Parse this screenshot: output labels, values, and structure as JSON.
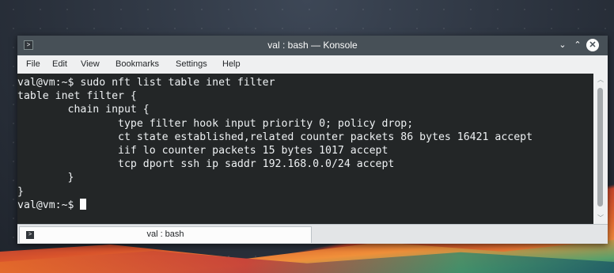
{
  "window": {
    "title": "val : bash — Konsole",
    "minimize_glyph": "⌄",
    "maximize_glyph": "⌃",
    "close_glyph": "✕",
    "app_icon": ">"
  },
  "menubar": {
    "items": [
      "File",
      "Edit",
      "View",
      "Bookmarks",
      "Settings",
      "Help"
    ]
  },
  "terminal": {
    "lines": [
      "val@vm:~$ sudo nft list table inet filter",
      "table inet filter {",
      "        chain input {",
      "                type filter hook input priority 0; policy drop;",
      "                ct state established,related counter packets 86 bytes 16421 accept",
      "                iif lo counter packets 15 bytes 1017 accept",
      "                tcp dport ssh ip saddr 192.168.0.0/24 accept",
      "        }",
      "}"
    ],
    "prompt": "val@vm:~$ "
  },
  "scrollbar": {
    "up_glyph": "︿",
    "down_glyph": "﹀"
  },
  "tabs": [
    {
      "label": "val : bash",
      "icon": ">"
    }
  ],
  "colors": {
    "titlebar": "#475057",
    "terminal_bg": "#232627",
    "terminal_fg": "#eef1f3"
  }
}
